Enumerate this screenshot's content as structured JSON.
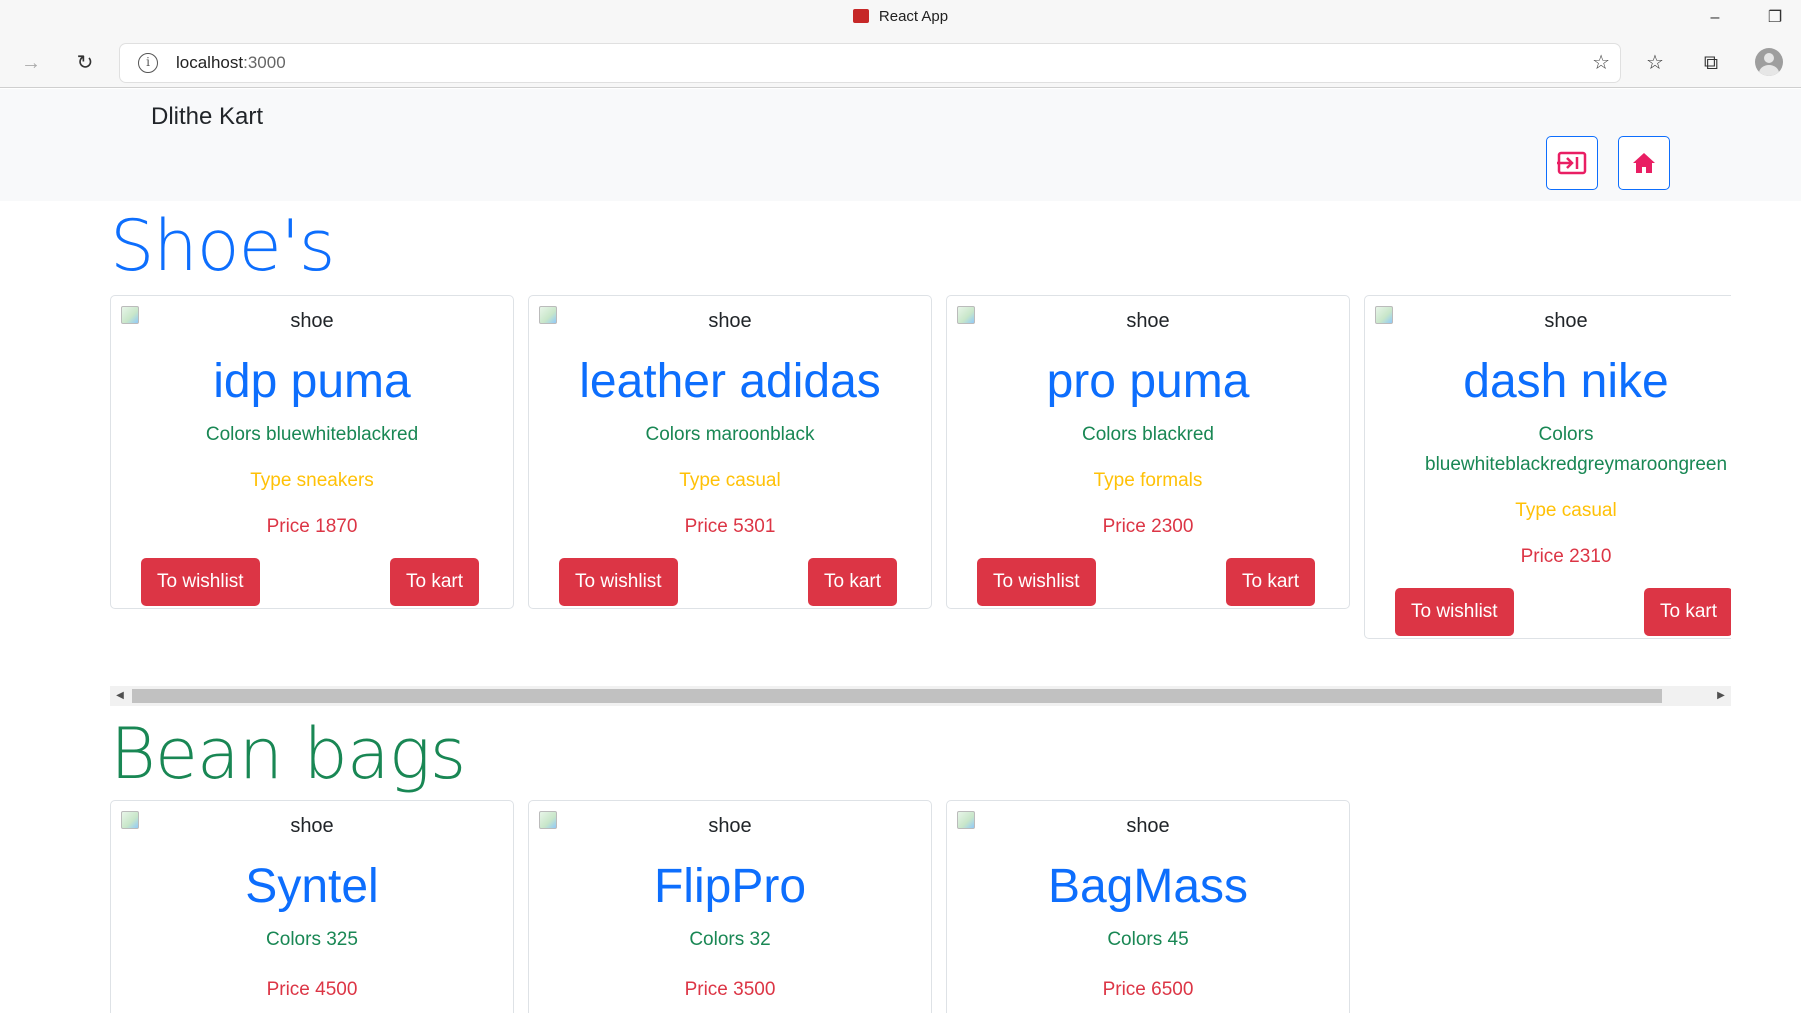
{
  "browser": {
    "tab_title": "React App",
    "url_host": "localhost",
    "url_port": ":3000"
  },
  "navbar": {
    "brand": "Dlithe Kart"
  },
  "sections": [
    {
      "title": "Shoe's",
      "color": "#0d6efd",
      "cards": [
        {
          "img_alt": "shoe",
          "name": "idp puma",
          "colors": "Colors bluewhiteblackred",
          "type": "Type sneakers",
          "price": "Price 1870",
          "wishlist": "To wishlist",
          "kart": "To kart"
        },
        {
          "img_alt": "shoe",
          "name": "leather adidas",
          "colors": "Colors maroonblack",
          "type": "Type casual",
          "price": "Price 5301",
          "wishlist": "To wishlist",
          "kart": "To kart"
        },
        {
          "img_alt": "shoe",
          "name": "pro puma",
          "colors": "Colors blackred",
          "type": "Type formals",
          "price": "Price 2300",
          "wishlist": "To wishlist",
          "kart": "To kart"
        },
        {
          "img_alt": "shoe",
          "name": "dash nike",
          "colors": "Colors bluewhiteblackredgreymaroongreen",
          "type": "Type casual",
          "price": "Price 2310",
          "wishlist": "To wishlist",
          "kart": "To kart"
        }
      ]
    },
    {
      "title": "Bean bags",
      "color": "#198754",
      "cards": [
        {
          "img_alt": "shoe",
          "name": "Syntel",
          "colors": "Colors 325",
          "price": "Price 4500"
        },
        {
          "img_alt": "shoe",
          "name": "FlipPro",
          "colors": "Colors 32",
          "price": "Price 3500"
        },
        {
          "img_alt": "shoe",
          "name": "BagMass",
          "colors": "Colors 45",
          "price": "Price 6500"
        }
      ]
    }
  ],
  "icons": {
    "login": "login-icon",
    "home": "home-icon"
  },
  "colors": {
    "primary": "#0d6efd",
    "success": "#198754",
    "warning": "#ffc107",
    "danger": "#dc3545",
    "home_icon": "#e91e63"
  }
}
